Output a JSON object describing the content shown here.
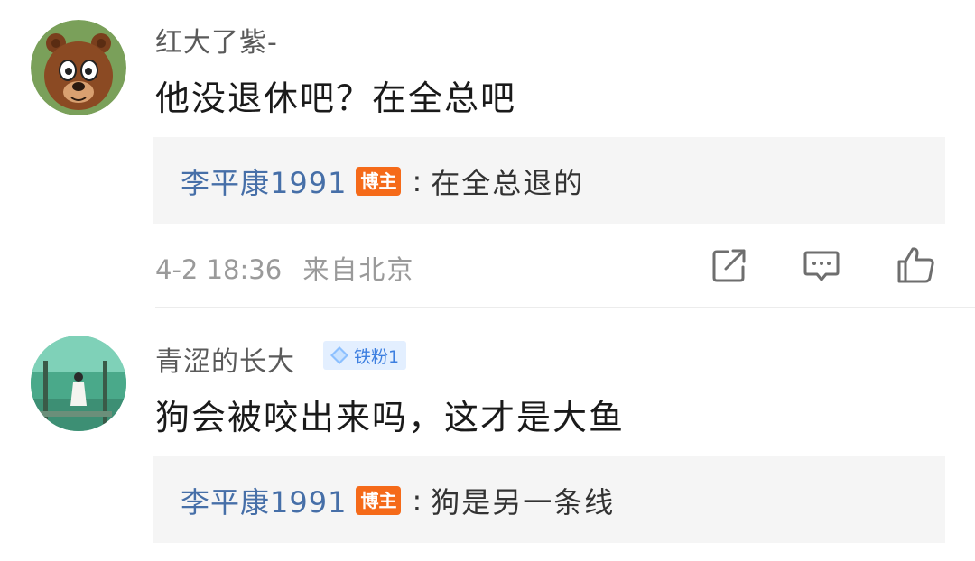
{
  "comments": [
    {
      "username": "红大了紫-",
      "avatar": "cartoon-bear-icon",
      "content": "他没退休吧？在全总吧",
      "reply": {
        "author": "李平康1991",
        "badge": "博主",
        "separator": ":",
        "text": "在全总退的"
      },
      "time": "4-2 18:36",
      "location": "来自北京",
      "actions": [
        "share-icon",
        "comment-icon",
        "like-icon"
      ]
    },
    {
      "username": "青涩的长大",
      "avatar": "seaside-girl-photo",
      "fan_badge": "铁粉1",
      "content": "狗会被咬出来吗，这才是大鱼",
      "reply": {
        "author": "李平康1991",
        "badge": "博主",
        "separator": ":",
        "text": "狗是另一条线"
      }
    }
  ],
  "colors": {
    "reply_author": "#466fa8",
    "blogger_badge": "#f56a19",
    "fan_badge_bg": "#e3efff",
    "fan_badge_text": "#3d7fe0",
    "meta_text": "#9a9a9a"
  }
}
